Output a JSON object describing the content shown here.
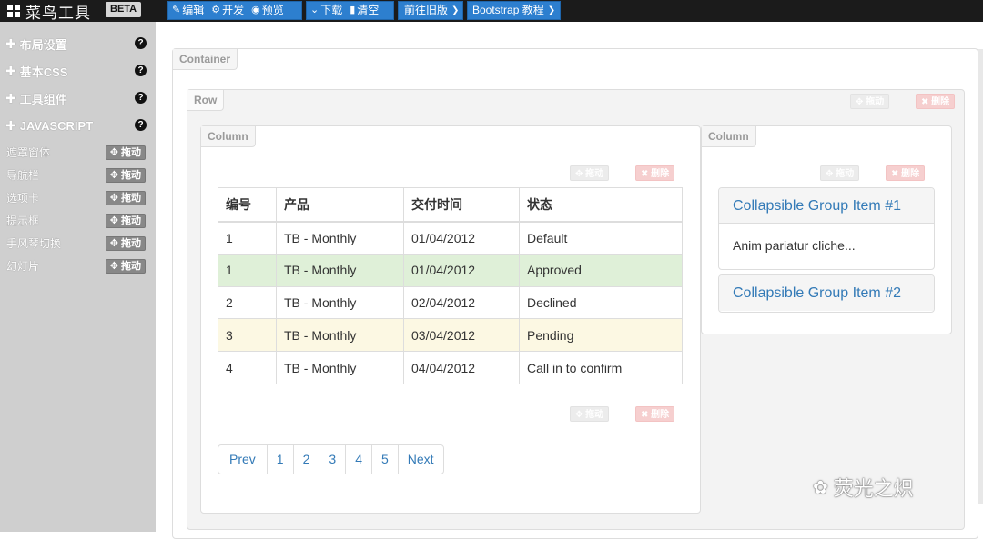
{
  "app": {
    "title": "菜鸟工具",
    "badge": "BETA"
  },
  "toolbar": {
    "edit": "编辑",
    "develop": "开发",
    "preview": "预览",
    "download": "下载",
    "clear": "清空",
    "old_version": "前往旧版",
    "bootstrap": "Bootstrap 教程"
  },
  "sidebar": {
    "sections": [
      {
        "label": "布局设置"
      },
      {
        "label": "基本CSS"
      },
      {
        "label": "工具组件"
      },
      {
        "label": "JAVASCRIPT"
      }
    ],
    "help": "?",
    "items": [
      {
        "label": "遮罩窗体"
      },
      {
        "label": "导航栏"
      },
      {
        "label": "选项卡"
      },
      {
        "label": "提示框"
      },
      {
        "label": "手风琴切换"
      },
      {
        "label": "幻灯片"
      }
    ],
    "drag_label": "拖动"
  },
  "canvas": {
    "container_tag": "Container",
    "row_tag": "Row",
    "column_tag": "Column",
    "drag": "拖动",
    "delete": "删除"
  },
  "table": {
    "headers": [
      "编号",
      "产品",
      "交付时间",
      "状态"
    ],
    "rows": [
      {
        "cells": [
          "1",
          "TB - Monthly",
          "01/04/2012",
          "Default"
        ],
        "style": "default"
      },
      {
        "cells": [
          "1",
          "TB - Monthly",
          "01/04/2012",
          "Approved"
        ],
        "style": "success"
      },
      {
        "cells": [
          "2",
          "TB - Monthly",
          "02/04/2012",
          "Declined"
        ],
        "style": "default"
      },
      {
        "cells": [
          "3",
          "TB - Monthly",
          "03/04/2012",
          "Pending"
        ],
        "style": "warning"
      },
      {
        "cells": [
          "4",
          "TB - Monthly",
          "04/04/2012",
          "Call in to confirm"
        ],
        "style": "default"
      }
    ]
  },
  "pagination": [
    "Prev",
    "1",
    "2",
    "3",
    "4",
    "5",
    "Next"
  ],
  "accordion": {
    "items": [
      {
        "title": "Collapsible Group Item #1",
        "body": "Anim pariatur cliche..."
      },
      {
        "title": "Collapsible Group Item #2"
      }
    ]
  },
  "watermark": "荧光之炽",
  "colors": {
    "toolbar_button": "#2d7fcf",
    "sidebar": "#cfcfcf",
    "link": "#337ab7",
    "success_row": "#dff0d8",
    "warning_row": "#fcf8e3"
  }
}
